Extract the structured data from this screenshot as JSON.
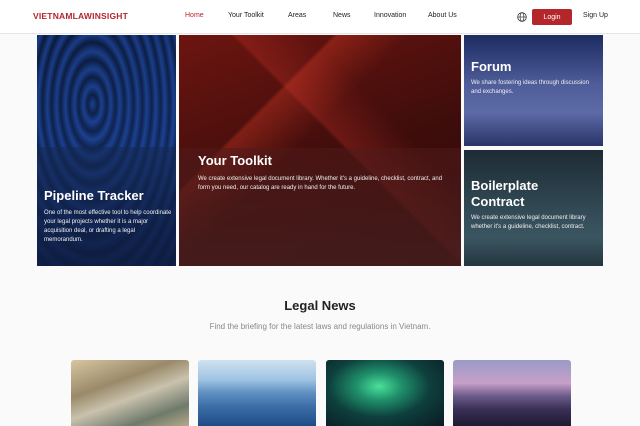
{
  "brand": "VIETNAMLAWINSIGHT",
  "nav": {
    "items": [
      {
        "label": "Home",
        "active": true
      },
      {
        "label": "Your Toolkit",
        "active": false
      },
      {
        "label": "Areas",
        "active": false
      },
      {
        "label": "News",
        "active": false
      },
      {
        "label": "Innovation",
        "active": false
      },
      {
        "label": "About Us",
        "active": false
      }
    ],
    "language_icon": "globe-icon",
    "login_label": "Login",
    "signup_label": "Sign Up"
  },
  "tiles": {
    "pipeline": {
      "title": "Pipeline Tracker",
      "description": "One of the most effective tool to help coordinate your legal projects whether it is a major acquisition deal, or drafting a legal memorandum."
    },
    "toolkit": {
      "title": "Your Toolkit",
      "description": "We create extensive legal document library. Whether it's a guideline, checklist, contract, and form you need, our catalog are ready in hand for the future."
    },
    "forum": {
      "title": "Forum",
      "description": "We share fostering ideas through discussion and exchanges."
    },
    "boilerplate": {
      "title": "Boilerplate Contract",
      "description": "We create extensive legal document library whether it's a guideline, checklist, contract."
    }
  },
  "legal_news": {
    "title": "Legal News",
    "subtitle": "Find the briefing for the latest laws and regulations in Vietnam."
  },
  "colors": {
    "accent": "#b3262c"
  }
}
